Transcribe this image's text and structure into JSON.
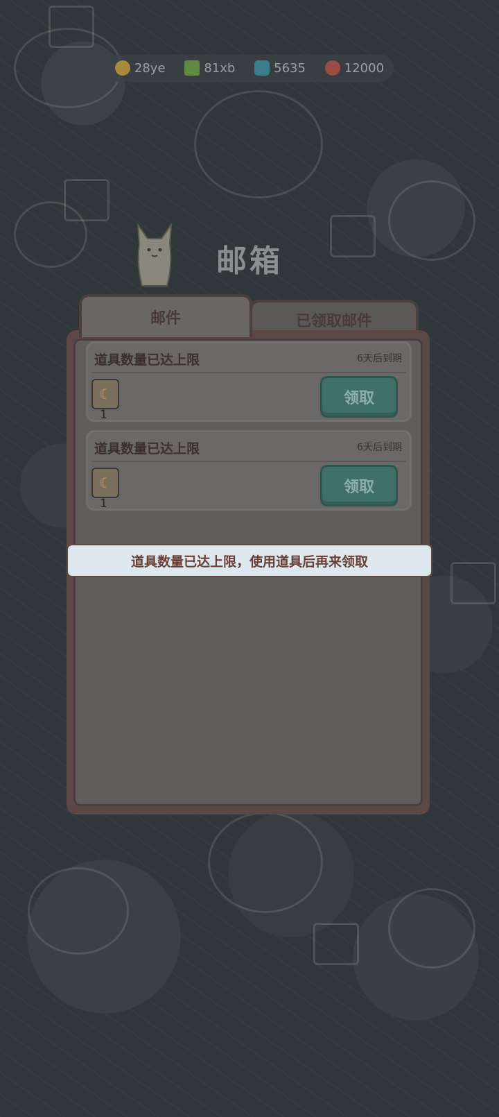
{
  "resources": [
    {
      "name": "gold-coin-icon",
      "value": "28ye",
      "color": "#b79a3e"
    },
    {
      "name": "energy-bolt-icon",
      "value": "81xb",
      "color": "#6f9a4e"
    },
    {
      "name": "gem-icon",
      "value": "5635",
      "color": "#3f8a99"
    },
    {
      "name": "red-orb-icon",
      "value": "12000",
      "color": "#a8554a"
    }
  ],
  "window": {
    "title": "邮箱"
  },
  "tabs": {
    "mail": "邮件",
    "claimed": "已领取邮件"
  },
  "mails": [
    {
      "title": "道具数量已达上限",
      "expire": "6天后到期",
      "item_count": "1",
      "claim": "领取"
    },
    {
      "title": "道具数量已达上限",
      "expire": "6天后到期",
      "item_count": "1",
      "claim": "领取"
    }
  ],
  "toast": "道具数量已达上限，使用道具后再来领取"
}
